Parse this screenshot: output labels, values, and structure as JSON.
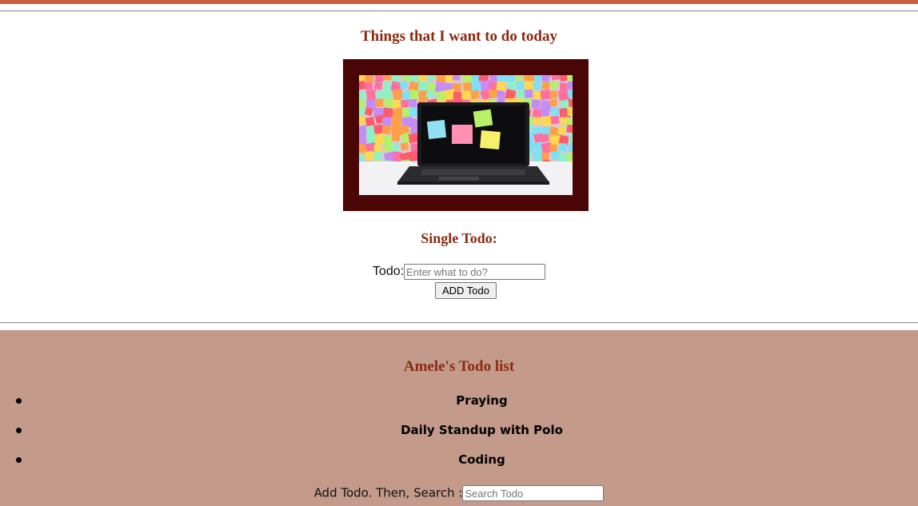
{
  "header": {
    "title": "Things that I want to do today",
    "accent_color": "#c8623e"
  },
  "single_todo": {
    "heading": "Single Todo:",
    "label": "Todo:",
    "placeholder": "Enter what to do?",
    "button_label": "ADD Todo"
  },
  "todo_list": {
    "heading": "Amele's Todo list",
    "items": [
      {
        "label": "Praying"
      },
      {
        "label": "Daily Standup with Polo"
      },
      {
        "label": "Coding"
      }
    ],
    "section_color": "#c49a8a"
  },
  "search": {
    "label": "Add Todo. Then, Search :",
    "placeholder": "Search Todo"
  },
  "image": {
    "icon": "laptop-sticky-notes-photo",
    "frame_color": "#4a0505"
  }
}
